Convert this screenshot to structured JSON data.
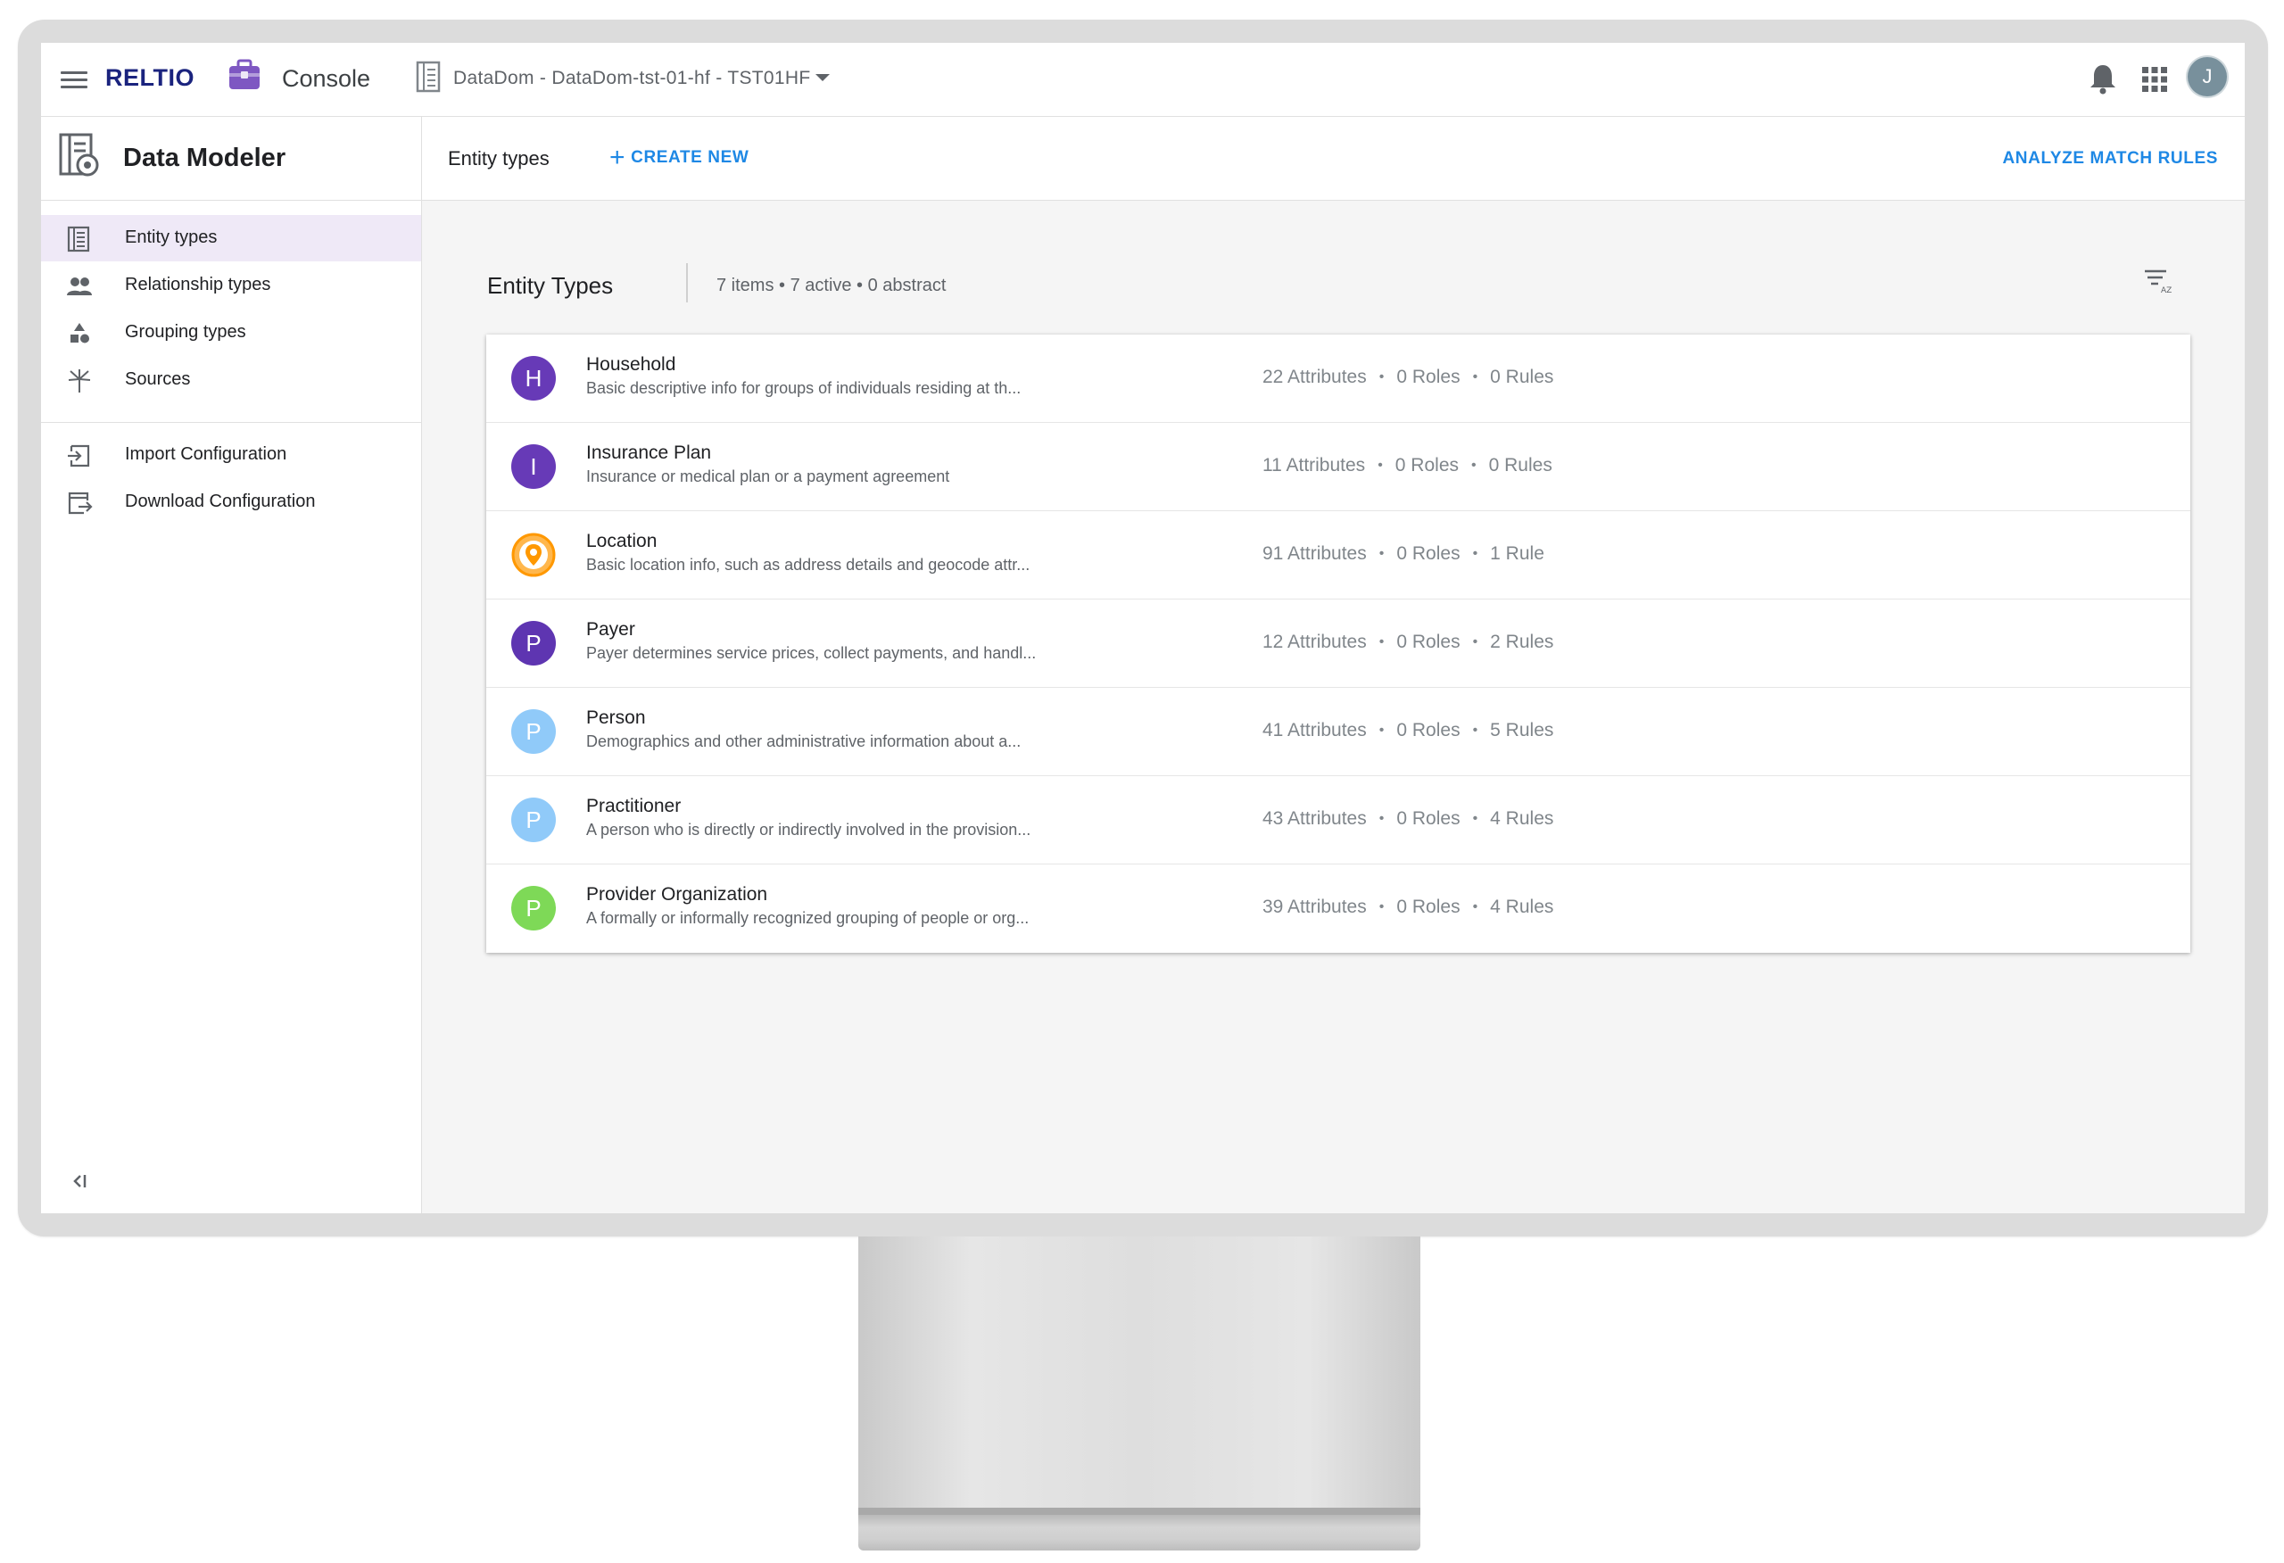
{
  "topbar": {
    "brand": "RELTIO",
    "console_label": "Console",
    "tenant_label": "DataDom - DataDom-tst-01-hf - TST01HF",
    "avatar_initial": "J",
    "brand_color": "#1a237e"
  },
  "sidebar": {
    "title": "Data Modeler",
    "items": [
      {
        "label": "Entity types",
        "icon": "entity-types-icon",
        "active": true
      },
      {
        "label": "Relationship types",
        "icon": "people-icon",
        "active": false
      },
      {
        "label": "Grouping types",
        "icon": "shapes-icon",
        "active": false
      },
      {
        "label": "Sources",
        "icon": "sources-icon",
        "active": false
      }
    ],
    "config_items": [
      {
        "label": "Import Configuration",
        "icon": "import-icon"
      },
      {
        "label": "Download Configuration",
        "icon": "download-icon"
      }
    ],
    "collapse_label": "<|"
  },
  "main": {
    "crumb": "Entity types",
    "create_label": "CREATE NEW",
    "analyze_label": "ANALYZE MATCH RULES",
    "section_title": "Entity Types",
    "section_meta": "7 items • 7 active • 0 abstract",
    "accent_color": "#1e88e5",
    "entities": [
      {
        "initial": "H",
        "color": "#673ab7",
        "name": "Household",
        "desc": "Basic descriptive info for groups of individuals residing at th...",
        "attributes": "22 Attributes",
        "roles": "0 Roles",
        "rules": "0 Rules"
      },
      {
        "initial": "I",
        "color": "#673ab7",
        "name": "Insurance Plan",
        "desc": "Insurance or medical plan or a payment agreement",
        "attributes": "11 Attributes",
        "roles": "0 Roles",
        "rules": "0 Rules"
      },
      {
        "initial": "",
        "color": "#ff9800",
        "name": "Location",
        "desc": "Basic location info, such as address details and geocode attr...",
        "attributes": "91 Attributes",
        "roles": "0 Roles",
        "rules": "1 Rule"
      },
      {
        "initial": "P",
        "color": "#5e35b1",
        "name": "Payer",
        "desc": "Payer determines service prices, collect payments, and handl...",
        "attributes": "12 Attributes",
        "roles": "0 Roles",
        "rules": "2 Rules"
      },
      {
        "initial": "P",
        "color": "#90caf9",
        "name": "Person",
        "desc": "Demographics and other administrative information about a...",
        "attributes": "41 Attributes",
        "roles": "0 Roles",
        "rules": "5 Rules"
      },
      {
        "initial": "P",
        "color": "#90caf9",
        "name": "Practitioner",
        "desc": "A person who is directly or indirectly involved in the provision...",
        "attributes": "43 Attributes",
        "roles": "0 Roles",
        "rules": "4 Rules"
      },
      {
        "initial": "P",
        "color": "#7ed957",
        "name": "Provider Organization",
        "desc": "A formally or informally recognized grouping of people or org...",
        "attributes": "39 Attributes",
        "roles": "0 Roles",
        "rules": "4 Rules"
      }
    ]
  }
}
